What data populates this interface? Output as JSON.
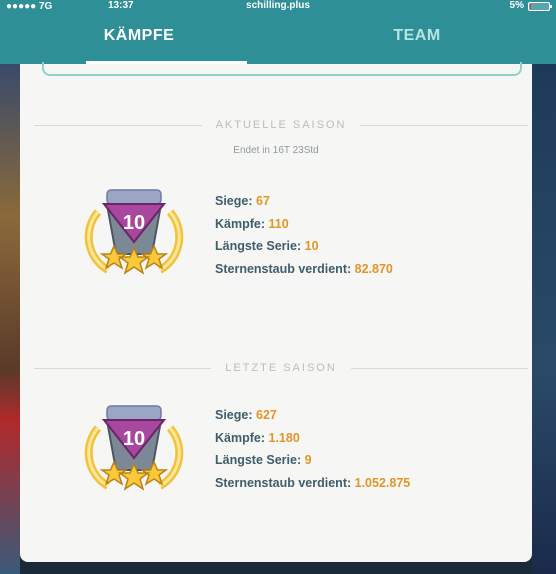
{
  "status_bar": {
    "carrier": "●●●●● 7G",
    "time": "13:37",
    "url": "schilling.plus",
    "battery": "5%",
    "battery_level": 0.05
  },
  "tabs": [
    {
      "label": "KÄMPFE",
      "active": true
    },
    {
      "label": "TEAM",
      "active": false
    }
  ],
  "current_season": {
    "header": "AKTUELLE SAISON",
    "ends_in": "Endet in 16T 23Std",
    "level": "10",
    "stats": [
      {
        "label": "Siege:",
        "value": "67"
      },
      {
        "label": "Kämpfe:",
        "value": "110"
      },
      {
        "label": "Längste Serie:",
        "value": "10"
      },
      {
        "label": "Sternenstaub verdient:",
        "value": "82.870"
      }
    ]
  },
  "last_season": {
    "header": "LETZTE SAISON",
    "level": "10",
    "stats": [
      {
        "label": "Siege:",
        "value": "627"
      },
      {
        "label": "Kämpfe:",
        "value": "1.180"
      },
      {
        "label": "Längste Serie:",
        "value": "9"
      },
      {
        "label": "Sternenstaub verdient:",
        "value": "1.052.875"
      }
    ]
  },
  "colors": {
    "header_teal": "#2f8f96",
    "stat_label": "#3f5e6b",
    "stat_value": "#e0952a",
    "medal_gold": "#f2c23a",
    "medal_purple": "#8a3a8c"
  },
  "icons": [
    "medal-icon",
    "star-icon"
  ]
}
